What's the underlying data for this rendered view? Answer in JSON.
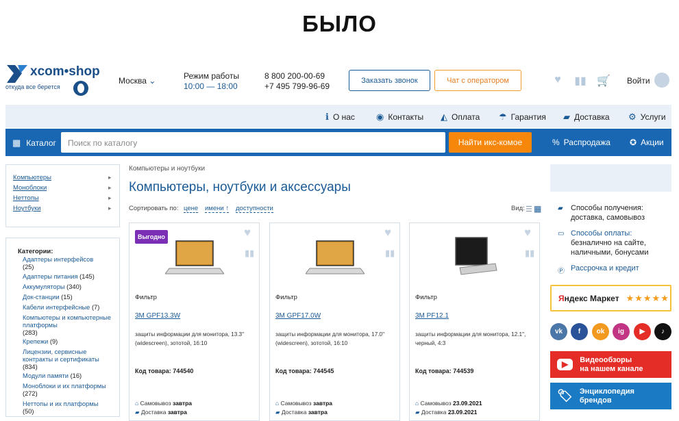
{
  "title": "БЫЛО",
  "header": {
    "logo_text": "xcom•shop",
    "logo_tagline": "откуда все берется",
    "city": "Москва",
    "hours_label": "Режим работы",
    "hours_value": "10:00 — 18:00",
    "phone1": "8 800 200-00-69",
    "phone2": "+7 495 799-96-69",
    "call_button": "Заказать звонок",
    "operator_button": "Чат с оператором",
    "login": "Войти"
  },
  "nav": {
    "about": "О нас",
    "contacts": "Контакты",
    "payment": "Оплата",
    "warranty": "Гарантия",
    "delivery": "Доставка",
    "services": "Услуги"
  },
  "bar": {
    "catalog": "Каталог",
    "search_placeholder": "Поиск по каталогу",
    "find_button": "Найти икс-комое",
    "sale": "Распродажа",
    "promo": "Акции"
  },
  "sidebar": {
    "top": [
      "Компьютеры",
      "Моноблоки",
      "Неттопы",
      "Ноутбуки"
    ],
    "categories_title": "Категории:",
    "categories": [
      {
        "name": "Адаптеры интерфейсов",
        "count": "(25)"
      },
      {
        "name": "Адаптеры питания",
        "count": "(145)"
      },
      {
        "name": "Аккумуляторы",
        "count": "(340)"
      },
      {
        "name": "Док-станции",
        "count": "(15)"
      },
      {
        "name": "Кабели интерфейсные",
        "count": "(7)"
      },
      {
        "name": "Компьютеры и компьютерные платформы",
        "count": "(283)"
      },
      {
        "name": "Крепежи",
        "count": "(9)"
      },
      {
        "name": "Лицензии, сервисные контракты и сертификаты",
        "count": "(834)"
      },
      {
        "name": "Модули памяти",
        "count": "(16)"
      },
      {
        "name": "Моноблоки и их платформы",
        "count": "(272)"
      },
      {
        "name": "Неттопы и их платформы",
        "count": "(50)"
      }
    ]
  },
  "main": {
    "breadcrumb": "Компьютеры и ноутбуки",
    "heading": "Компьютеры, ноутбуки и аксессуары",
    "sort_label": "Сортировать по:",
    "sort_price": "цене",
    "sort_name": "имени ↑",
    "sort_avail": "доступности",
    "view_label": "Вид:",
    "products": [
      {
        "badge": "Выгодно",
        "type": "Фильтр",
        "name": "3M GPF13.3W",
        "desc": "защиты информации для монитора, 13.3\" (widescreen), зототой, 16:10",
        "code": "Код товара: 744540",
        "pickup_label": "Самовывоз",
        "pickup": "завтра",
        "delivery_label": "Доставка",
        "delivery": "завтра"
      },
      {
        "badge": "",
        "type": "Фильтр",
        "name": "3M GPF17.0W",
        "desc": "защиты информации для монитора, 17.0\" (widescreen), зототой, 16:10",
        "code": "Код товара: 744545",
        "pickup_label": "Самовывоз",
        "pickup": "завтра",
        "delivery_label": "Доставка",
        "delivery": "завтра"
      },
      {
        "badge": "",
        "type": "Фильтр",
        "name": "3M PF12.1",
        "desc": "защиты информации для монитора, 12.1\", черный, 4:3",
        "code": "Код товара: 744539",
        "pickup_label": "Самовывоз",
        "pickup": "23.09.2021",
        "delivery_label": "Доставка",
        "delivery": "23.09.2021"
      }
    ]
  },
  "right": {
    "get_label": "Способы получения:",
    "get_value": "доставка, самовывоз",
    "pay_label": "Способы оплаты:",
    "pay_value1": "безналично на сайте,",
    "pay_value2": "наличными, бонусами",
    "credit": "Рассрочка и кредит",
    "ym_name_a": "Я",
    "ym_name_b": "ндекс Маркет",
    "ym_stars": "★★★★★",
    "socials": [
      "vk",
      "f",
      "ok",
      "ig",
      "▶",
      "♪"
    ],
    "video1": "Видеообзоры",
    "video2": "на нашем канале",
    "enc1": "Энциклопедия",
    "enc2": "брендов"
  }
}
